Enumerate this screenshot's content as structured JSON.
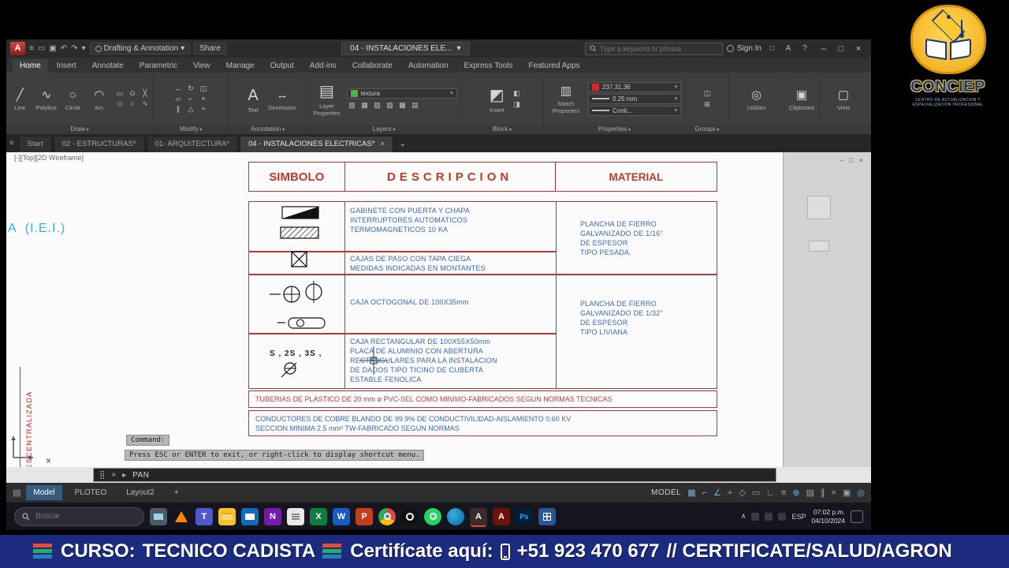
{
  "icons": {
    "dropdown": "▾",
    "minimize": "–",
    "maximize": "□",
    "close": "×",
    "help": "?",
    "hamburger": "≡",
    "alert": "A",
    "sb_menu": "▤",
    "chevron_up": "∧",
    "xmark": "×",
    "drag": "⣿",
    "cmd_arrow": "▸",
    "word": "W",
    "excel": "X",
    "powerpoint": "P",
    "onenote": "N",
    "teams": "T",
    "autocad": "A",
    "acrobat": "A",
    "photoshop": "Ps"
  },
  "titlebar": {
    "app_initial": "A",
    "workspace": "Drafting & Annotation",
    "share": "Share",
    "doc_title": "04 - INSTALACIONES ELE...",
    "search_placeholder": "Type a keyword or phrase",
    "sign_in": "Sign In"
  },
  "qat_icons": [
    "≡",
    "▭",
    "▣",
    "↶",
    "↷",
    "▾"
  ],
  "ribbon_tabs": [
    "Home",
    "Insert",
    "Annotate",
    "Parametric",
    "View",
    "Manage",
    "Output",
    "Add-ins",
    "Collaborate",
    "Automation",
    "Express Tools",
    "Featured Apps"
  ],
  "ribbon": {
    "draw": {
      "tools": [
        {
          "glyph": "╱",
          "label": "Line"
        },
        {
          "glyph": "∿",
          "label": "Polyline"
        },
        {
          "glyph": "○",
          "label": "Circle"
        },
        {
          "glyph": "◠",
          "label": "Arc"
        }
      ],
      "extra": [
        "▭",
        "⊙",
        "╳",
        "◇",
        "○",
        "∿"
      ]
    },
    "modify": {
      "glyphs": [
        "↔",
        "↻",
        "◫",
        "▱",
        "⌐",
        "×",
        "∥",
        "△",
        "+"
      ]
    },
    "annotation": {
      "text_glyph": "A",
      "text_label": "Text",
      "dim_glyph": "↔",
      "dim_label": "Dimension"
    },
    "layers": {
      "big_glyph": "▤",
      "big_label": "Layer Properties",
      "layer_value": "textura",
      "glyphs": [
        "▥",
        "▦",
        "▧",
        "▨",
        "▩",
        "▤"
      ]
    },
    "block": {
      "big_glyph": "◩",
      "big_label": "Insert",
      "glyphs": [
        "◧",
        "◨"
      ]
    },
    "properties": {
      "big_glyph": "▥",
      "big_label": "Match Properties",
      "color_value": "237,31,36",
      "lineweight": "0.25 mm",
      "linetype": "Conti..."
    },
    "groups": {
      "glyphs": [
        "◫",
        "⊞"
      ]
    },
    "utilities_glyph": "◎",
    "utilities_label": "Utilities",
    "clipboard_glyph": "▣",
    "clipboard_label": "Clipboard",
    "view_glyph": "▢",
    "view_label": "View",
    "panel_labels": [
      "Draw",
      "Modify",
      "Annotation",
      "Layers",
      "Block",
      "Properties",
      "Groups"
    ]
  },
  "file_tabs": [
    "Start",
    "02 - ESTRUCTURAS*",
    "01- ARQUITECTURA*",
    "04 - INSTALACIONES ELECTRICAS*"
  ],
  "viewport_label": "[-][Top][2D Wireframe]",
  "drawing": {
    "cyan_label": "A  (I.E.I.)",
    "vertical_label": "A DESCENTRALIZADA",
    "s_label": "S , 2S , 3S ,"
  },
  "table": {
    "h_simbolo": "SIMBOLO",
    "h_descripcion": "DESCRIPCION",
    "h_material": "MATERIAL",
    "r1_desc": "GABINETE CON PUERTA Y CHAPA\nINTERRUPTORES AUTOMATICOS\nTERMOMAGNETICOS 10 KA",
    "r2_desc": "CAJAS DE PASO CON TAPA CIEGA\nMEDIDAS INDICADAS EN MONTANTES",
    "r3_desc": "CAJA OCTOGONAL DE 100X35mm",
    "r4_desc": "CAJA RECTANGULAR DE 100X55X50mm\nPLACA DE ALUMINIO CON ABERTURA\nRECTANGULARES PARA LA INSTALACION\nDE DADOS TIPO TICINO DE CUBERTA\nESTABLE FENOLICA",
    "m1": "PLANCHA DE FIERRO\nGALVANIZADO DE 1/16\"\nDE ESPESOR\nTIPO PESADA.",
    "m2": "PLANCHA DE FIERRO\nGALVANIZADO DE 1/32\"\nDE ESPESOR\nTIPO LIVIANA",
    "full1": "TUBERIAS DE PLASTICO DE 20 mm ø PVC-SEL COMO MINIMO-FABRICADOS SEGUN NORMAS TECNICAS",
    "full2": "CONDUCTORES DE COBRE BLANDO DE 99.9% DE CONDUCTIVILIDAD-AISLAMIENTO 0.60 KV\nSECCION MINIMA 2.5 mm² TW-FABRICADO SEGUN NORMAS"
  },
  "command": {
    "tooltip": "Command:",
    "message": "Press ESC or ENTER to exit, or right-click to display shortcut menu.",
    "current": "PAN"
  },
  "statusbar": {
    "tabs": [
      "Model",
      "PLOTEO",
      "Layout2"
    ],
    "plus": "+",
    "space": "MODEL",
    "icons": [
      "▦",
      "⌐",
      "∠",
      "+",
      "◇",
      "▭",
      "∟",
      "≡",
      "⊕",
      "▤",
      "∥",
      "×",
      "▣",
      "◎"
    ]
  },
  "taskbar": {
    "search_placeholder": "Buscar",
    "language": "ESP",
    "time": "07:02 p.m.",
    "date": "04/10/2024"
  },
  "logo": {
    "name": "CONCIEP",
    "tagline": "CENTRO DE ACTUALIZACION Y ESPECIALIZACION PROFESIONAL"
  },
  "banner": {
    "curso": "CURSO:",
    "course_name": "TECNICO CADISTA",
    "cert": "Certifícate aquí:",
    "phone": "+51 923 470 677",
    "rest": "// CERTIFICATE/SALUD/AGRON"
  }
}
